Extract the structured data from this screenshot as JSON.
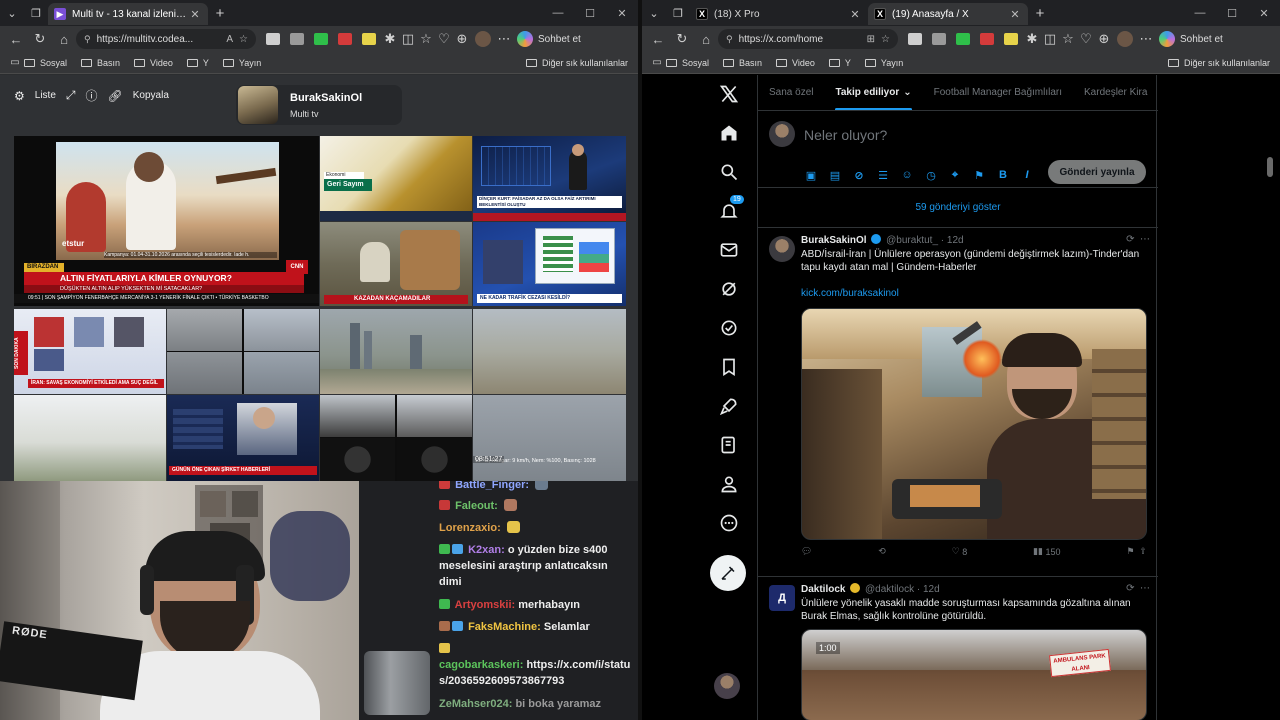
{
  "left_window": {
    "tabs": [
      {
        "title": "Multi tv - 13 kanal izleniyor",
        "active": true
      }
    ],
    "address": "https://multitv.codea...",
    "copilot_label": "Sohbet et",
    "bookmarks": [
      "Sosyal",
      "Basın",
      "Video",
      "Y",
      "Yayın"
    ],
    "bookmarks_other": "Diğer sık kullanılanlar",
    "multitv": {
      "tool_list": "Liste",
      "tool_copy": "Kopyala",
      "profile_name": "BurakSakinOl",
      "profile_sub": "Multi tv"
    },
    "tiles": {
      "big_banner_top": "BİRAZDAN",
      "big_banner": "ALTIN FİYATLARIYLA KİMLER OYNUYOR?",
      "big_sub": "DÜŞÜKTEN ALTIN ALIP YÜKSEKTEN Mİ SATACAKLAR?",
      "big_ticker": "09:51 | SON ŞAMPİYON FENERBAHÇE MERCANİYA 3-1 YENERİK FİNALE ÇIKTI  • TÜRKİYE BASKETBO",
      "big_caption": "Kampanya: 01.04-31.10.2026 arasında seçili tesislerdedir. İade h.",
      "big_logo": "etstur",
      "tile2_label": "Geri Sayım",
      "tile3_caption": "DİNÇER KURT: FAİSADAR AZ DA OLSA FAİZ ARTIRIMI BEKLENTİSİ OLUŞTU",
      "tile5_banner": "KAZADAN KAÇAMADILAR",
      "tile6_banner": "NE KADAR TRAFİK CEZASI KESİLDİ?",
      "tile7_tag": "SON DAKİKA",
      "tile7_banner": "İRAN: SAVAŞ EKONOMİYİ ETKİLEDİ AMA SUÇ DEĞİL",
      "tile_news_banner": "GÜNÜN ÖNE ÇIKAN ŞİRKET HABERLERİ",
      "cam_stamp": "08:51:27",
      "weather_text": "11 °C, Rüzgar: 9 km/h, Nem: %100, Basınç: 1028"
    },
    "chat": [
      {
        "user": "Battle_Finger:",
        "text": "",
        "color": "#8fa6ff",
        "badges": [
          "#cc3b3b"
        ],
        "emote": "#6b7c8f"
      },
      {
        "user": "Faleout:",
        "text": "",
        "color": "#6ec26a",
        "badges": [
          "#c73838"
        ],
        "emote": "#b07860"
      },
      {
        "user": "Lorenzaxio:",
        "text": "",
        "color": "#e0a24a",
        "badges": [],
        "emote": "#e5c34a"
      },
      {
        "user": "K2xan:",
        "text": "o yüzden bize s400 meselesini araştırıp anlatıcaksın dimi",
        "color": "#b07ee6",
        "badges": [
          "#3fb950",
          "#4aa3e8"
        ],
        "emote": ""
      },
      {
        "user": "Artyomskii:",
        "text": "merhabayın",
        "color": "#d94040",
        "badges": [
          "#3fb950"
        ],
        "emote": ""
      },
      {
        "user": "FaksMachine:",
        "text": "Selamlar",
        "color": "#f0c442",
        "badges": [
          "#a86c4c",
          "#4aa3e8"
        ],
        "emote": ""
      },
      {
        "user": "cagobarkaskeri:",
        "text": "https://x.com/i/status/2036592609573867793",
        "color": "#5cc45c",
        "badges": [
          "#e5c34a"
        ],
        "emote": ""
      },
      {
        "user": "ZeMahser024:",
        "text": "bi boka yaramaz",
        "color": "#7fae7f",
        "badges": [],
        "emote": ""
      }
    ],
    "webcam_mic_text": "RØDE"
  },
  "right_window": {
    "tabs": [
      {
        "title": "(18) X Pro",
        "active": false
      },
      {
        "title": "(19) Anasayfa / X",
        "active": true
      }
    ],
    "address": "https://x.com/home",
    "copilot_label": "Sohbet et",
    "bookmarks": [
      "Sosyal",
      "Basın",
      "Video",
      "Y",
      "Yayın"
    ],
    "bookmarks_other": "Diğer sık kullanılanlar",
    "x": {
      "notif_count": "19",
      "feed_tabs": [
        "Sana özel",
        "Takip ediliyor",
        "Football Manager Bağımlıları",
        "Kardeşler Kira"
      ],
      "active_tab": 1,
      "composer_placeholder": "Neler oluyor?",
      "post_button": "Gönderi yayınla",
      "show_more": "59 gönderiyi göster",
      "tweets": [
        {
          "name": "BurakSakinOl",
          "handle": "@buraktut_ · 12d",
          "text": "ABD/İsrail-İran | Ünlülere operasyon (gündemi değiştirmek lazım)-Tinder'dan tapu kaydı atan mal | Gündem-Haberler",
          "link": "kick.com/buraksakinol",
          "likes": "8",
          "views": "150"
        },
        {
          "name": "Daktilock",
          "handle": "@daktilock · 12d",
          "text": "Ünlülere yönelik yasaklı madde soruşturması kapsamında gözaltına alınan Burak Elmas, sağlık kontrolüne götürüldü.",
          "video_time": "1:00",
          "media_sign": "AMBULANS PARK ALANI"
        }
      ]
    }
  },
  "colors": {
    "x_blue": "#1d9bf0",
    "chrome_bg": "#202124",
    "toolbar_bg": "#353638"
  }
}
